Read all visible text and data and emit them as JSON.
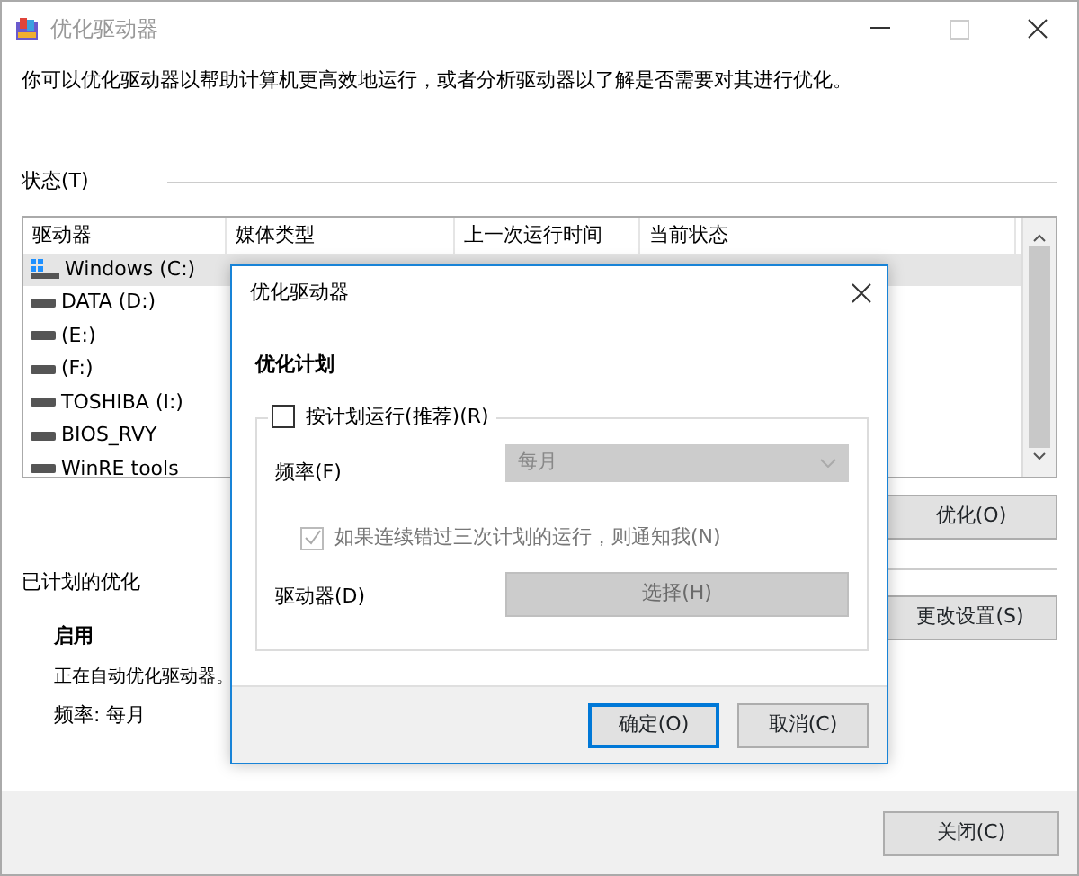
{
  "window": {
    "title": "优化驱动器"
  },
  "description": "你可以优化驱动器以帮助计算机更高效地运行，或者分析驱动器以了解是否需要对其进行优化。",
  "status_label": "状态(T)",
  "table": {
    "columns": [
      "驱动器",
      "媒体类型",
      "上一次运行时间",
      "当前状态"
    ],
    "rows": [
      {
        "drive": "Windows (C:)",
        "kind": "system",
        "selected": true
      },
      {
        "drive": "DATA (D:)",
        "kind": "disk",
        "selected": false
      },
      {
        "drive": "(E:)",
        "kind": "disk",
        "selected": false
      },
      {
        "drive": "(F:)",
        "kind": "disk",
        "selected": false
      },
      {
        "drive": "TOSHIBA (I:)",
        "kind": "disk",
        "selected": false
      },
      {
        "drive": "BIOS_RVY",
        "kind": "disk",
        "selected": false
      },
      {
        "drive": "WinRE tools",
        "kind": "disk",
        "selected": false
      }
    ]
  },
  "optimize_button": "优化(O)",
  "schedule": {
    "heading": "已计划的优化",
    "state": "启用",
    "message": "正在自动优化驱动器。",
    "frequency": "频率: 每月",
    "button": "更改设置(S)"
  },
  "close_button": "关闭(C)",
  "dialog": {
    "title": "优化驱动器",
    "heading": "优化计划",
    "run_on_schedule": {
      "label": "按计划运行(推荐)(R)",
      "checked": false
    },
    "frequency": {
      "label": "频率(F)",
      "value": "每月",
      "disabled": true
    },
    "notify": {
      "label": "如果连续错过三次计划的运行，则通知我(N)",
      "checked": true,
      "disabled": true
    },
    "drives": {
      "label": "驱动器(D)",
      "button": "选择(H)",
      "disabled": true
    },
    "buttons": [
      {
        "label": "确定(O)",
        "default": true
      },
      {
        "label": "取消(C)",
        "default": false
      }
    ]
  }
}
